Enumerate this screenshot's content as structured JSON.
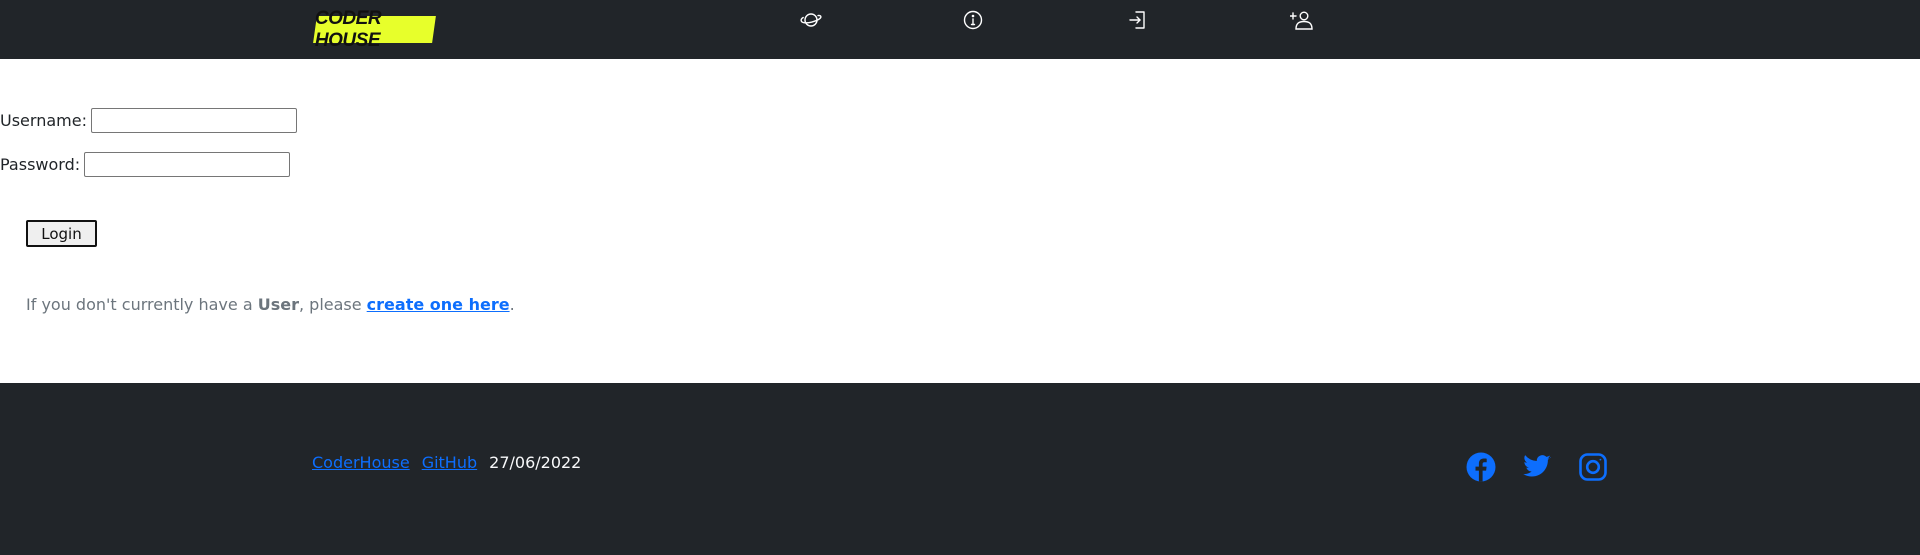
{
  "navbar": {
    "logo_text": "CODER HOUSE",
    "icons": [
      "planet-icon",
      "info-circle-icon",
      "login-icon",
      "add-user-icon"
    ]
  },
  "form": {
    "username_label": "Username:",
    "username_value": "",
    "password_label": "Password:",
    "password_value": "",
    "login_button": "Login"
  },
  "signup": {
    "prefix": "If you don't currently have a ",
    "bold_word": "User",
    "middle": ", please ",
    "link_text": "create one here",
    "suffix": "."
  },
  "footer": {
    "links": [
      "CoderHouse",
      "GitHub"
    ],
    "date": "27/06/2022",
    "social": [
      "facebook-icon",
      "twitter-icon",
      "instagram-icon"
    ]
  },
  "colors": {
    "dark_bg": "#212529",
    "logo_yellow": "#e7ff2b",
    "link_blue": "#0d6efd",
    "muted_text": "#6c757d"
  }
}
